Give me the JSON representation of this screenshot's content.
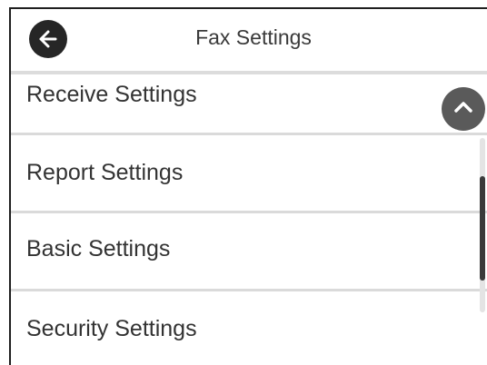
{
  "header": {
    "title": "Fax Settings",
    "back_icon": "arrow-left-icon"
  },
  "menu": {
    "items": [
      {
        "label": "Receive Settings"
      },
      {
        "label": "Report Settings"
      },
      {
        "label": "Basic Settings"
      },
      {
        "label": "Security Settings"
      }
    ]
  },
  "scroll": {
    "up_icon": "chevron-up-icon",
    "position_fraction": 0.55,
    "visible_fraction": 0.6
  },
  "colors": {
    "back_button": "#262626",
    "scroll_button": "#5a5a5a",
    "divider": "#dadada"
  }
}
